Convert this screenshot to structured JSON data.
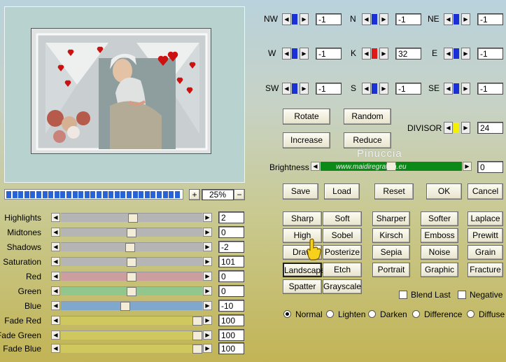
{
  "matrix": {
    "nw": {
      "label": "NW",
      "value": "-1"
    },
    "n": {
      "label": "N",
      "value": "-1"
    },
    "ne": {
      "label": "NE",
      "value": "-1"
    },
    "w": {
      "label": "W",
      "value": "-1"
    },
    "k": {
      "label": "K",
      "value": "32"
    },
    "e": {
      "label": "E",
      "value": "-1"
    },
    "sw": {
      "label": "SW",
      "value": "-1"
    },
    "s": {
      "label": "S",
      "value": "-1"
    },
    "se": {
      "label": "SE",
      "value": "-1"
    }
  },
  "ops": {
    "rotate": "Rotate",
    "random": "Random",
    "increase": "Increase",
    "reduce": "Reduce"
  },
  "divisor": {
    "label": "DIVISOR",
    "value": "24"
  },
  "watermark": {
    "line1": "Pinuccia",
    "line2": "www.maidiregrafica.eu"
  },
  "brightness": {
    "label": "Brightness",
    "value": "0",
    "level_fraction": 0.5
  },
  "actions": {
    "save": "Save",
    "load": "Load",
    "reset": "Reset",
    "ok": "OK",
    "cancel": "Cancel"
  },
  "zoom": {
    "plus": "+",
    "minus": "−",
    "value": "25%",
    "progress_fraction": 1.0
  },
  "sliders": [
    {
      "label": "Highlights",
      "value": "2",
      "level": 0.51,
      "color": "#b5b5b5"
    },
    {
      "label": "Midtones",
      "value": "0",
      "level": 0.5,
      "color": "#b5b5b5"
    },
    {
      "label": "Shadows",
      "value": "-2",
      "level": 0.49,
      "color": "#b5b5b5"
    },
    {
      "label": "Saturation",
      "value": "101",
      "level": 0.5,
      "color": "#b5b5b5"
    },
    {
      "label": "Red",
      "value": "0",
      "level": 0.5,
      "color": "#cc9ea0"
    },
    {
      "label": "Green",
      "value": "0",
      "level": 0.5,
      "color": "#92c68f"
    },
    {
      "label": "Blue",
      "value": "-10",
      "level": 0.45,
      "color": "#80a8cc"
    },
    {
      "label": "Fade Red",
      "value": "100",
      "level": 1.0,
      "color": "#cfc85e"
    },
    {
      "label": "Fade Green",
      "value": "100",
      "level": 1.0,
      "color": "#cfc85e"
    },
    {
      "label": "Fade Blue",
      "value": "100",
      "level": 1.0,
      "color": "#cfc85e"
    }
  ],
  "filters": [
    "Sharp",
    "Soft",
    "Sharper",
    "Softer",
    "Laplace",
    "High Pass",
    "Sobel",
    "Kirsch",
    "Emboss",
    "Prewitt",
    "Draw",
    "Posterize",
    "Sepia",
    "Noise",
    "Grain",
    "Landscape",
    "Etch",
    "Portrait",
    "Graphic",
    "Fracture",
    "Spatter",
    "Grayscale"
  ],
  "filter_pressed": "Landscape",
  "checks": {
    "blend_last": "Blend Last",
    "negative": "Negative"
  },
  "blend_modes": [
    "Normal",
    "Lighten",
    "Darken",
    "Difference",
    "Diffuse"
  ],
  "blend_selected": "Normal",
  "colors": {
    "marker_blue": "#1a2fd6",
    "marker_red": "#e01818",
    "marker_yellow": "#f5f000",
    "brightness_green": "#0b8a1a"
  }
}
